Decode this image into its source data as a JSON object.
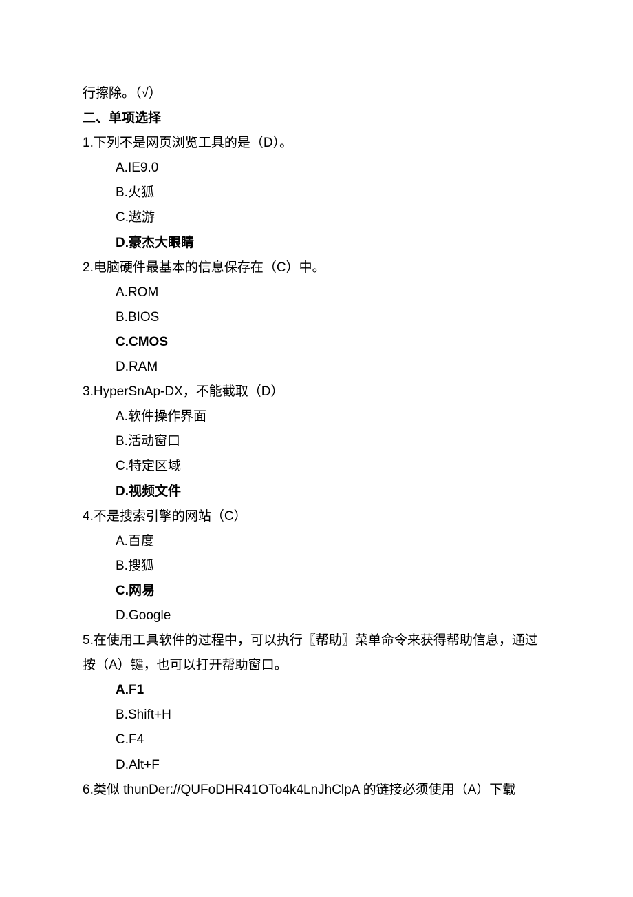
{
  "intro_fragment": "行擦除。（√）",
  "section_heading": "二、单项选择",
  "questions": [
    {
      "stem": "1.下列不是网页浏览工具的是（D）。",
      "options": [
        {
          "text": "A.IE9.0",
          "bold": false
        },
        {
          "text": "B.火狐",
          "bold": false
        },
        {
          "text": "C.遨游",
          "bold": false
        },
        {
          "text": "D.豪杰大眼睛",
          "bold": true
        }
      ]
    },
    {
      "stem": "2.电脑硬件最基本的信息保存在（C）中。",
      "options": [
        {
          "text": "A.ROM",
          "bold": false
        },
        {
          "text": "B.BIOS",
          "bold": false
        },
        {
          "text": "C.CMOS",
          "bold": true
        },
        {
          "text": "D.RAM",
          "bold": false
        }
      ]
    },
    {
      "stem": "3.HyperSnAp-DX，不能截取（D）",
      "options": [
        {
          "text": "A.软件操作界面",
          "bold": false
        },
        {
          "text": "B.活动窗口",
          "bold": false
        },
        {
          "text": "C.特定区域",
          "bold": false
        },
        {
          "text": "D.视频文件",
          "bold": true
        }
      ]
    },
    {
      "stem": "4.不是搜索引擎的网站（C）",
      "options": [
        {
          "text": "A.百度",
          "bold": false
        },
        {
          "text": "B.搜狐",
          "bold": false
        },
        {
          "text": "C.网易",
          "bold": true
        },
        {
          "text": "D.Google",
          "bold": false
        }
      ]
    },
    {
      "stem": "5.在使用工具软件的过程中，可以执行〖帮助〗菜单命令来获得帮助信息，通过按（A）键，也可以打开帮助窗口。",
      "options": [
        {
          "text": "A.F1",
          "bold": true
        },
        {
          "text": "B.Shift+H",
          "bold": false
        },
        {
          "text": "C.F4",
          "bold": false
        },
        {
          "text": "D.Alt+F",
          "bold": false
        }
      ]
    },
    {
      "stem": "6.类似 thunDer://QUFoDHR41OTo4k4LnJhClpA 的链接必须使用（A）下载",
      "options": []
    }
  ]
}
